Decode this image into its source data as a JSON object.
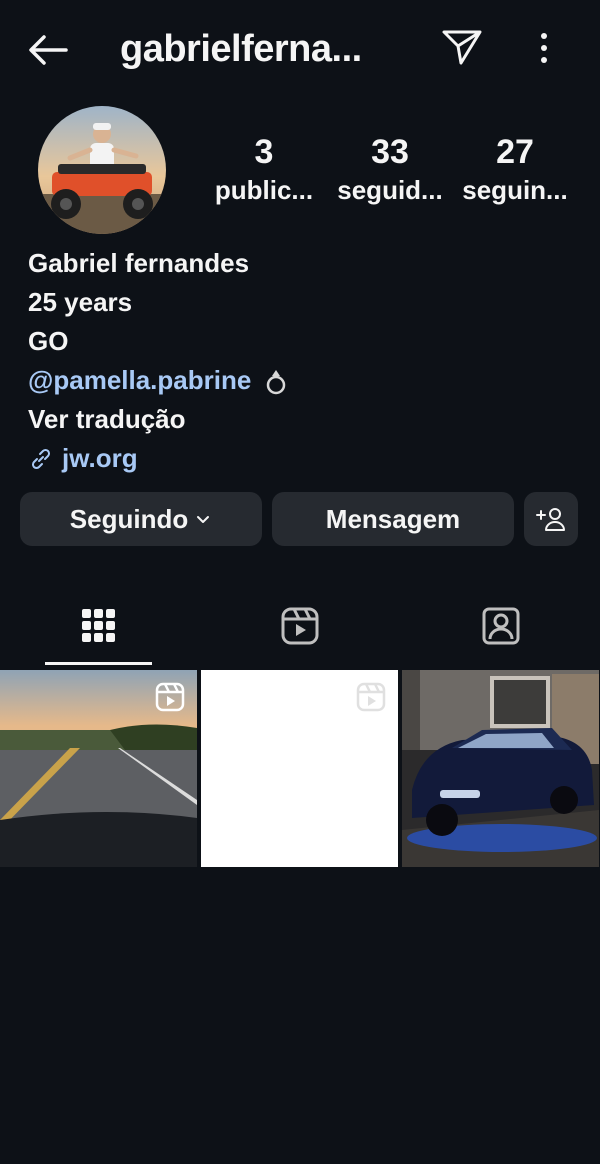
{
  "header": {
    "title": "gabrielferna...",
    "back_icon": "arrow-left-icon",
    "send_icon": "paper-plane-icon",
    "more_icon": "kebab-menu-icon"
  },
  "profile": {
    "avatar_alt": "profile photo",
    "stats": [
      {
        "value": "3",
        "label": "public..."
      },
      {
        "value": "33",
        "label": "seguid..."
      },
      {
        "value": "27",
        "label": "seguin..."
      }
    ],
    "bio": {
      "name": "Gabriel fernandes",
      "line2": "25 years",
      "line3": "GO",
      "mention": "@pamella.pabrine",
      "mention_emoji": "ring",
      "translate": "Ver tradução",
      "link": "jw.org"
    }
  },
  "actions": {
    "following_label": "Seguindo",
    "message_label": "Mensagem"
  },
  "tabs": [
    {
      "name": "grid",
      "icon": "grid-icon"
    },
    {
      "name": "reels",
      "icon": "reels-icon"
    },
    {
      "name": "tagged",
      "icon": "tagged-user-icon"
    }
  ],
  "colors": {
    "background": "#0d1117",
    "button": "#262a30",
    "link": "#a8c9f5"
  }
}
